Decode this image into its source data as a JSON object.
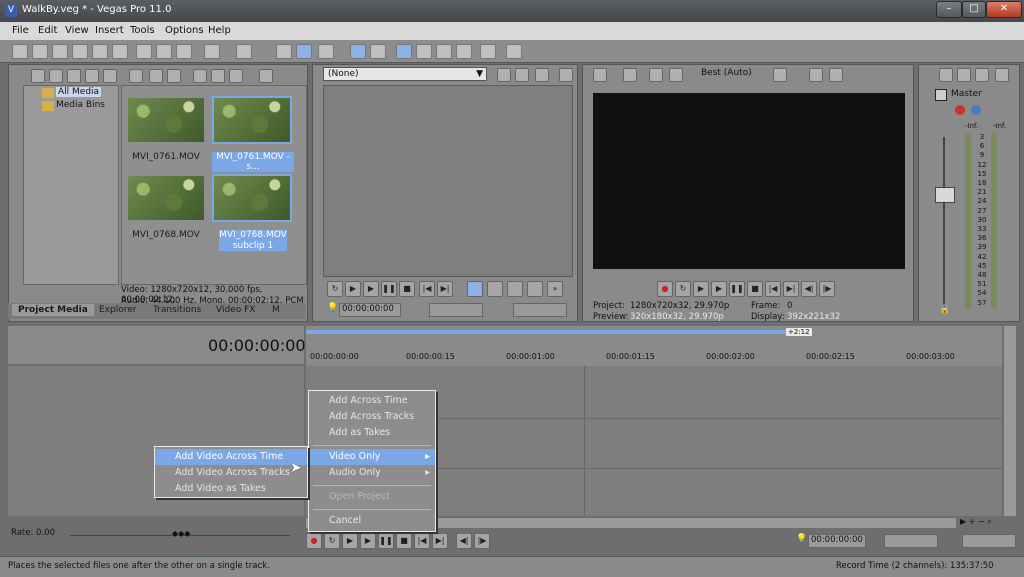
{
  "window": {
    "title": "WalkBy.veg * - Vegas Pro 11.0"
  },
  "menu": [
    "File",
    "Edit",
    "View",
    "Insert",
    "Tools",
    "Options",
    "Help"
  ],
  "media_tree": {
    "all_media": "All Media",
    "media_bins": "Media Bins"
  },
  "media": [
    {
      "name": "MVI_0761.MOV"
    },
    {
      "name": "MVI_0761.MOV - s..."
    },
    {
      "name": "MVI_0768.MOV"
    },
    {
      "name": "MVI_0768.MOV -",
      "name2": "subclip 1"
    }
  ],
  "media_info": {
    "video": "Video: 1280x720x12, 30.000 fps, 00:00:02:12,",
    "audio": "Audio: 44,100 Hz, Mono, 00:00:02:12, PCM"
  },
  "tabs": [
    "Project Media",
    "Explorer",
    "Transitions",
    "Video FX",
    "M"
  ],
  "trimmer": {
    "dropdown": "(None)",
    "time": "00:00:00:00"
  },
  "preview": {
    "quality": "Best (Auto)",
    "project_label": "Project:",
    "project_value": "1280x720x32, 29.970p",
    "preview_label": "Preview:",
    "preview_value": "320x180x32, 29.970p",
    "frame_label": "Frame:",
    "frame_value": "0",
    "display_label": "Display:",
    "display_value": "392x221x32"
  },
  "master": {
    "label": "Master",
    "inf_left": "-Inf.",
    "inf_right": "-Inf.",
    "scale": [
      "3",
      "6",
      "9",
      "12",
      "15",
      "18",
      "21",
      "24",
      "27",
      "30",
      "33",
      "36",
      "39",
      "42",
      "45",
      "48",
      "51",
      "54",
      "57"
    ]
  },
  "timeline": {
    "time": "00:00:00:00",
    "marker": "+2:12",
    "ruler": [
      "00:00:00:00",
      "00:00:00:15",
      "00:00:01:00",
      "00:00:01:15",
      "00:00:02:00",
      "00:00:02:15",
      "00:00:03:00"
    ],
    "rate": "Rate: 0.00",
    "bottom_time": "00:00:00:00"
  },
  "context_menu": {
    "items": [
      "Add Across Time",
      "Add Across Tracks",
      "Add as Takes",
      "Video Only",
      "Audio Only",
      "Open Project",
      "Cancel"
    ]
  },
  "submenu": {
    "items": [
      "Add Video Across Time",
      "Add Video Across Tracks",
      "Add Video as Takes"
    ]
  },
  "status": {
    "message": "Places the selected files one after the other on a single track.",
    "record_time": "Record Time (2 channels): 135:37:50"
  }
}
